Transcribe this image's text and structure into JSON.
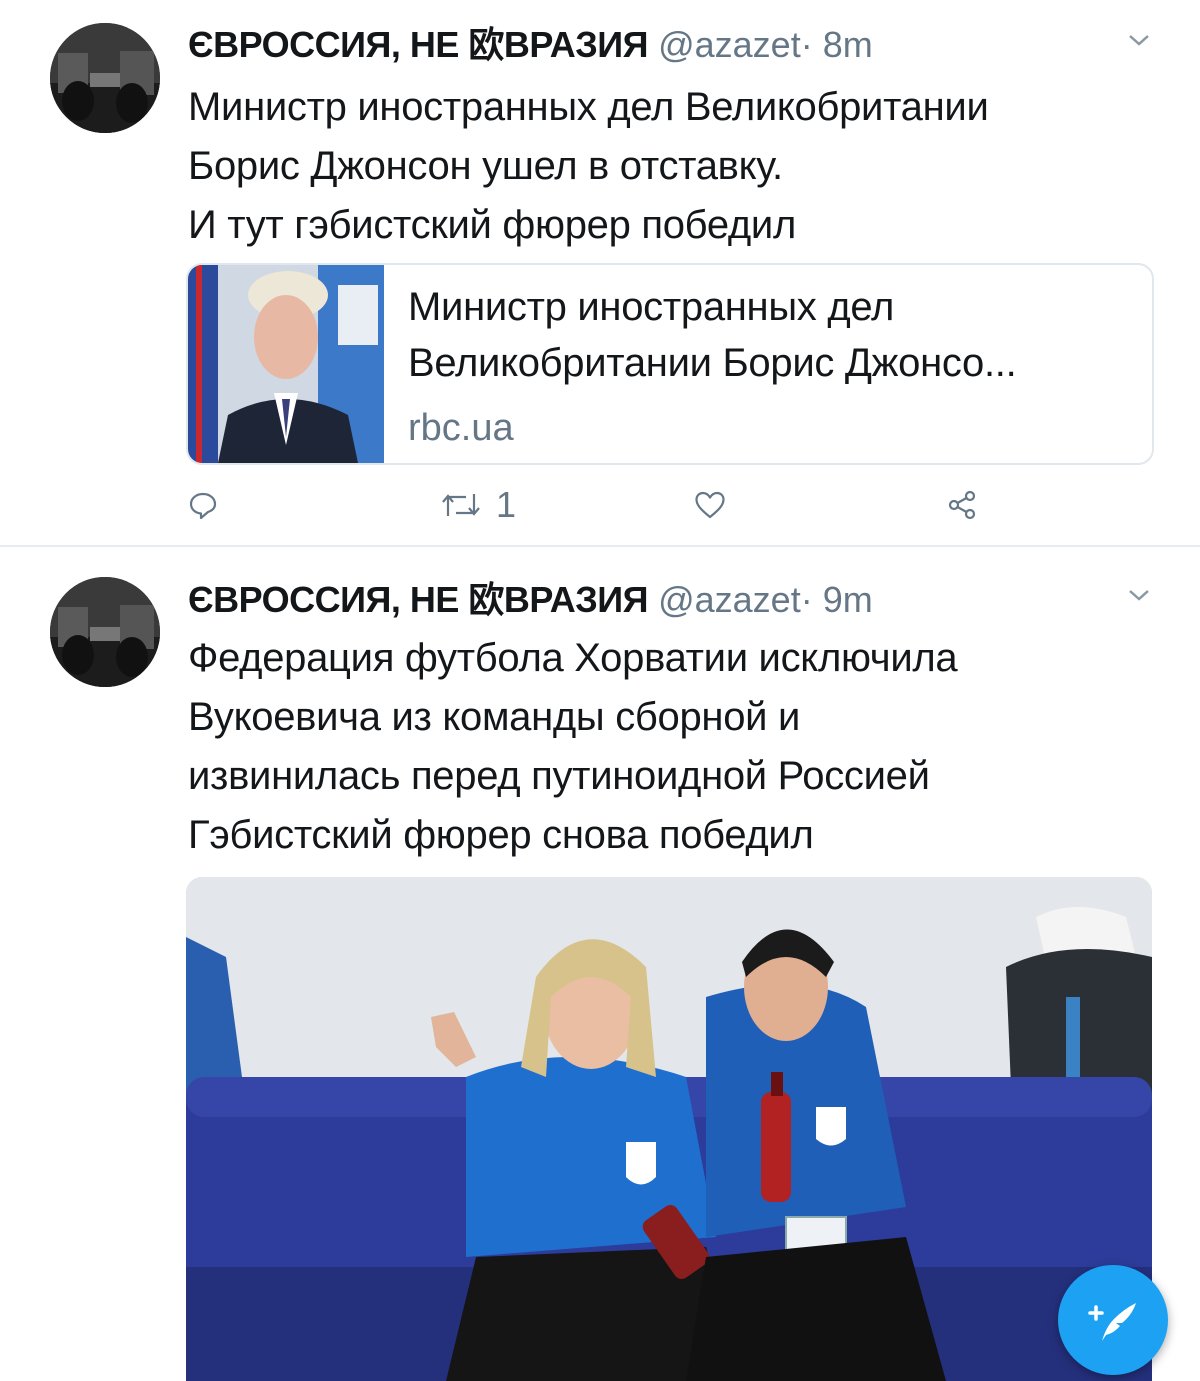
{
  "tweets": [
    {
      "user": {
        "name": "ЄВРОССИЯ, НЕ 欧ВРАЗИЯ",
        "handle": "@azazet",
        "separator": "·",
        "time": "8m"
      },
      "text": [
        "Министр иностранных дел Великобритании",
        "Борис Джонсон ушел в отставку.",
        "И тут гэбистский фюрер победил"
      ],
      "card": {
        "title_line1": "Министр иностранных дел",
        "title_line2": "Великобритании Борис Джонсо...",
        "domain": "rbc.ua"
      },
      "actions": {
        "reply_icon": "reply-icon",
        "retweet_icon": "retweet-icon",
        "retweet_count": "1",
        "like_icon": "heart-icon",
        "share_icon": "share-icon"
      }
    },
    {
      "user": {
        "name": "ЄВРОССИЯ, НЕ 欧ВРАЗИЯ",
        "handle": "@azazet",
        "separator": "·",
        "time": "9m"
      },
      "text": [
        "Федерация футбола Хорватии исключила",
        "Вукоевича из команды сборной и",
        "извинилась перед путиноидной Россией",
        "Гэбистский фюрер снова победил"
      ]
    }
  ],
  "fab": {
    "icon": "compose-tweet-icon"
  },
  "colors": {
    "accent": "#1da1f2",
    "text": "#14171a",
    "muted": "#657786",
    "divider": "#e6ecf0"
  }
}
